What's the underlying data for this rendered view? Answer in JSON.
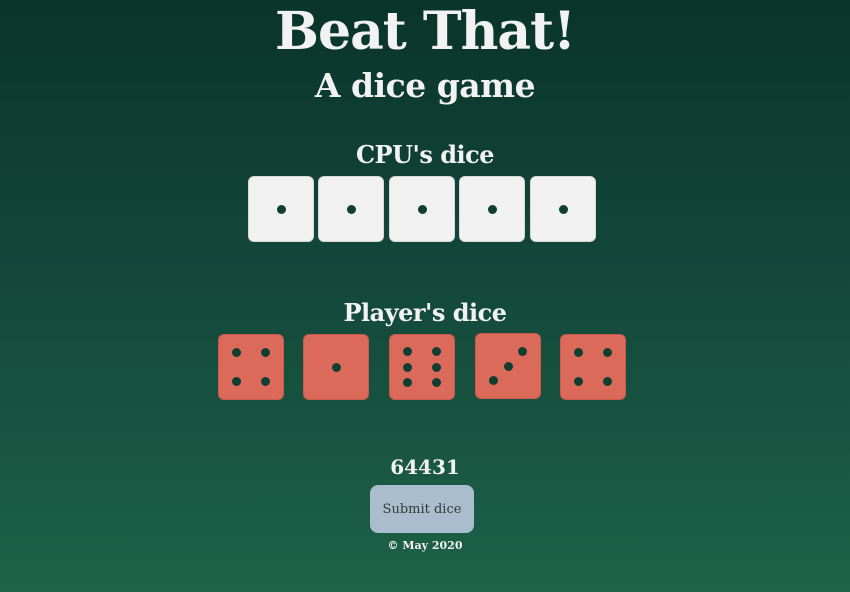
{
  "header": {
    "title": "Beat That!",
    "subtitle": "A dice game"
  },
  "cpu": {
    "label": "CPU's dice",
    "dice": [
      1,
      1,
      1,
      1,
      1
    ]
  },
  "player": {
    "label": "Player's dice",
    "dice": [
      4,
      1,
      6,
      3,
      4
    ]
  },
  "score": "64431",
  "submit": {
    "label": "Submit dice"
  },
  "footer": {
    "copyright": "© May 2020"
  },
  "colors": {
    "cpu_die": "#f1f1f1",
    "player_die": "#dc6a5b",
    "pip": "#103f31",
    "button": "#a9bdcc"
  }
}
